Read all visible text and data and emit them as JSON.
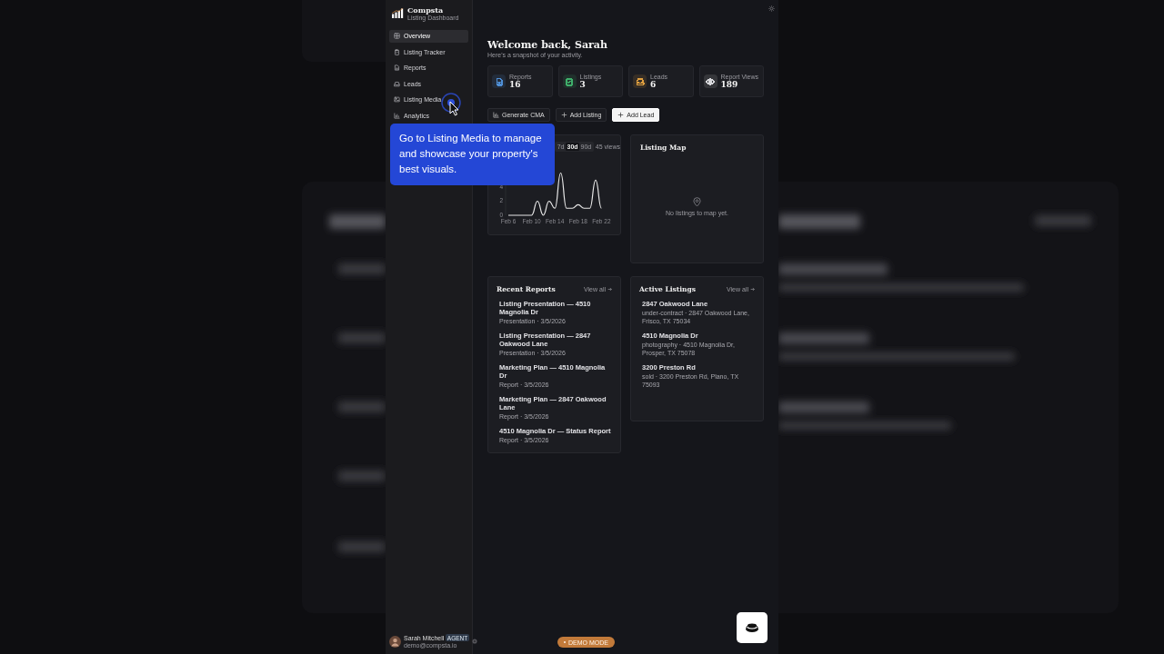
{
  "sidebar": {
    "brand": "Compsta",
    "tagline": "Listing Dashboard",
    "items": [
      {
        "label": "Overview",
        "selected": true
      },
      {
        "label": "Listing Tracker",
        "selected": false
      },
      {
        "label": "Reports",
        "selected": false
      },
      {
        "label": "Leads",
        "selected": false
      },
      {
        "label": "Listing Media",
        "selected": false
      },
      {
        "label": "Analytics",
        "selected": false
      }
    ],
    "user": {
      "name": "Sarah Mitchell",
      "badge": "AGENT",
      "email": "demo@compsta.io"
    }
  },
  "header": {
    "title": "Welcome back, Sarah",
    "subtitle": "Here's a snapshot of your activity."
  },
  "stats": [
    {
      "label": "Reports",
      "value": "16",
      "color": "#4f8fd6"
    },
    {
      "label": "Listings",
      "value": "3",
      "color": "#3fae6a"
    },
    {
      "label": "Leads",
      "value": "6",
      "color": "#e0a040"
    },
    {
      "label": "Report Views",
      "value": "189",
      "color": "#d8d8dc"
    }
  ],
  "actions": [
    {
      "label": "Generate CMA",
      "primary": false
    },
    {
      "label": "Add Listing",
      "primary": false
    },
    {
      "label": "Add Lead",
      "primary": true
    }
  ],
  "views": {
    "ranges": [
      {
        "label": "7d",
        "selected": false
      },
      {
        "label": "30d",
        "selected": true
      },
      {
        "label": "90d",
        "selected": false
      }
    ],
    "total": "45 views",
    "chart_data": {
      "type": "line",
      "categories": [
        "Feb 6",
        null,
        null,
        null,
        "Feb 10",
        null,
        null,
        null,
        "Feb 14",
        null,
        null,
        null,
        "Feb 18",
        null,
        null,
        null,
        "Feb 22"
      ],
      "series": [
        {
          "color": "#e6e6e6",
          "values": [
            0,
            0,
            0,
            0,
            0,
            2,
            0,
            2,
            1,
            6,
            1,
            1,
            1.5,
            1,
            1,
            5,
            1
          ]
        }
      ],
      "ylim": [
        0,
        6.5
      ],
      "yticks": [
        0,
        2,
        4
      ]
    }
  },
  "map": {
    "title": "Listing Map",
    "empty": "No listings to map yet."
  },
  "recent_reports": {
    "title": "Recent Reports",
    "link": "View all",
    "items": [
      {
        "title": "Listing Presentation — 4510 Magnolia Dr",
        "meta": "Presentation · 3/5/2026"
      },
      {
        "title": "Listing Presentation — 2847 Oakwood Lane",
        "meta": "Presentation · 3/5/2026"
      },
      {
        "title": "Marketing Plan — 4510 Magnolia Dr",
        "meta": "Report · 3/5/2026"
      },
      {
        "title": "Marketing Plan — 2847 Oakwood Lane",
        "meta": "Report · 3/5/2026"
      },
      {
        "title": "4510 Magnolia Dr — Status Report",
        "meta": "Report · 3/5/2026"
      }
    ]
  },
  "active_listings": {
    "title": "Active Listings",
    "link": "View all",
    "items": [
      {
        "title": "2847 Oakwood Lane",
        "meta": "under-contract · 2847 Oakwood Lane, Frisco, TX 75034"
      },
      {
        "title": "4510 Magnolia Dr",
        "meta": "photography · 4510 Magnolia Dr, Prosper, TX 75078"
      },
      {
        "title": "3200 Preston Rd",
        "meta": "sold · 3200 Preston Rd, Plano, TX 75093"
      }
    ]
  },
  "demo_badge": "DEMO MODE",
  "tooltip": "Go to Listing Media to manage and showcase your property's best visuals."
}
